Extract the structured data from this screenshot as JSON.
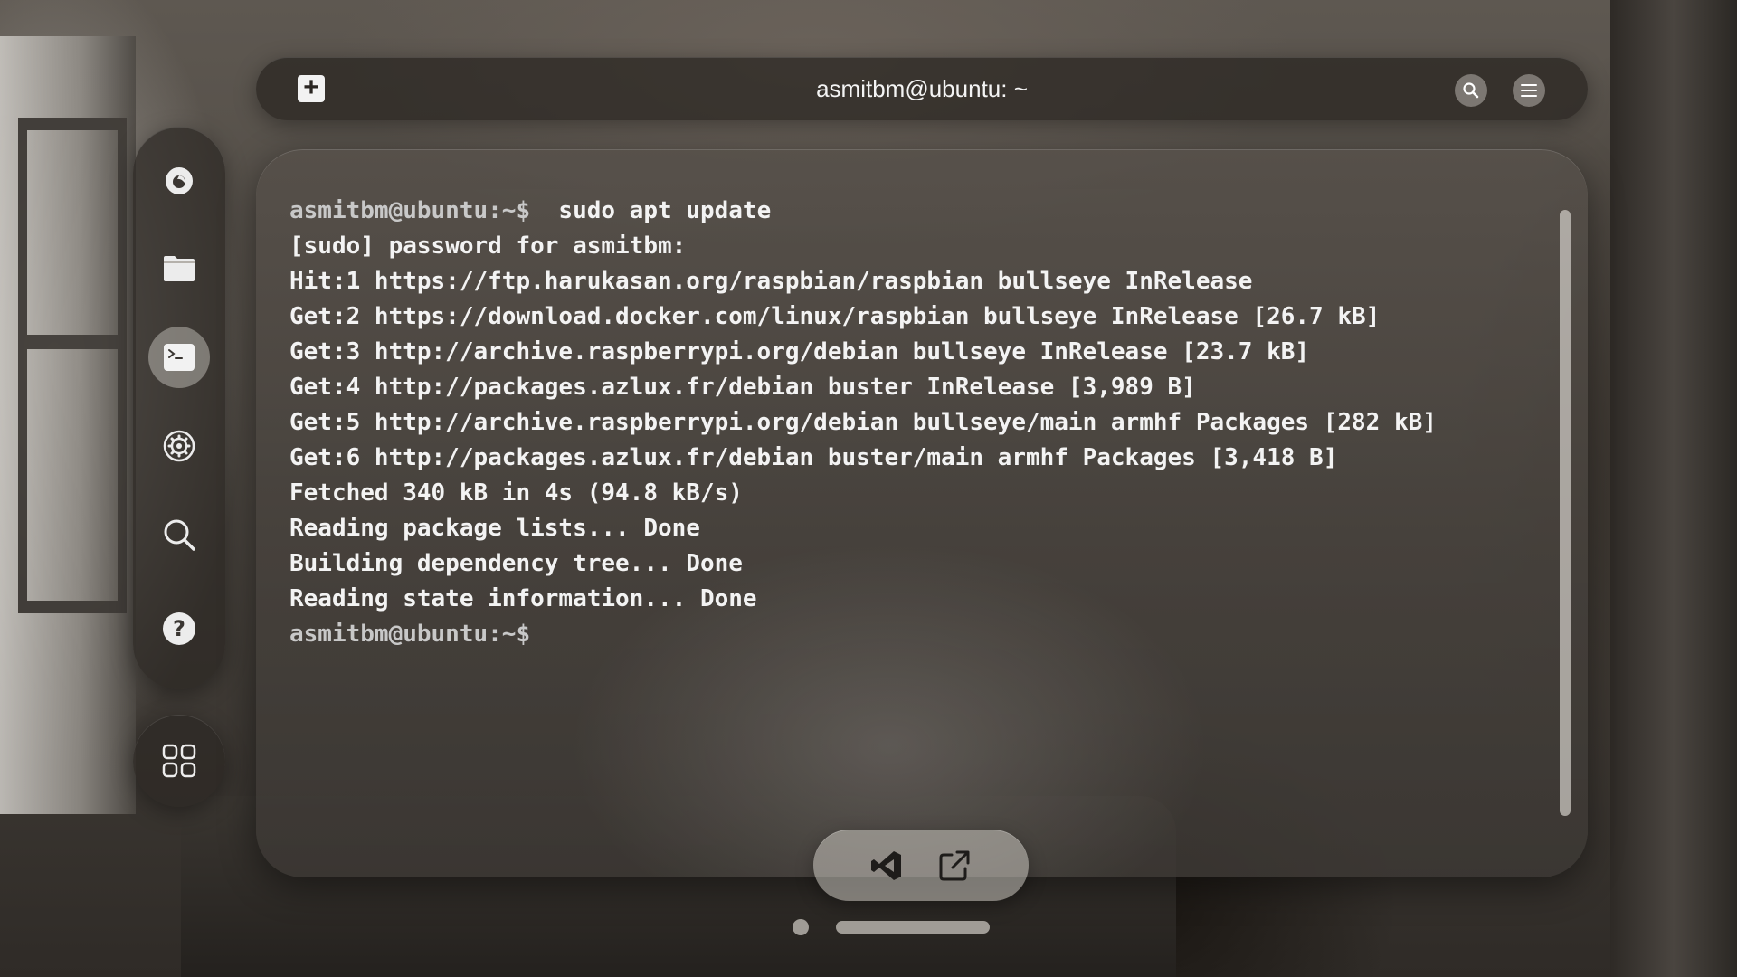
{
  "window": {
    "title": "asmitbm@ubuntu: ~"
  },
  "topbar": {
    "new_tab_icon": "plus-square-icon",
    "search_icon": "search-icon",
    "menu_icon": "hamburger-menu-icon"
  },
  "dock": {
    "items": [
      {
        "name": "firefox",
        "icon": "firefox-icon",
        "active": false
      },
      {
        "name": "files",
        "icon": "folder-icon",
        "active": false
      },
      {
        "name": "terminal",
        "icon": "terminal-icon",
        "active": true
      },
      {
        "name": "settings",
        "icon": "gear-icon",
        "active": false
      },
      {
        "name": "search",
        "icon": "search-icon",
        "active": false
      },
      {
        "name": "help",
        "icon": "help-icon",
        "active": false
      }
    ],
    "apps_icon": "app-grid-icon"
  },
  "terminal": {
    "lines": [
      {
        "prompt": "asmitbm@ubuntu:~$",
        "text": "  sudo apt update"
      },
      {
        "prompt": "",
        "text": "[sudo] password for asmitbm:"
      },
      {
        "prompt": "",
        "text": "Hit:1 https://ftp.harukasan.org/raspbian/raspbian bullseye InRelease"
      },
      {
        "prompt": "",
        "text": "Get:2 https://download.docker.com/linux/raspbian bullseye InRelease [26.7 kB]"
      },
      {
        "prompt": "",
        "text": "Get:3 http://archive.raspberrypi.org/debian bullseye InRelease [23.7 kB]"
      },
      {
        "prompt": "",
        "text": "Get:4 http://packages.azlux.fr/debian buster InRelease [3,989 B]"
      },
      {
        "prompt": "",
        "text": "Get:5 http://archive.raspberrypi.org/debian bullseye/main armhf Packages [282 kB]"
      },
      {
        "prompt": "",
        "text": "Get:6 http://packages.azlux.fr/debian buster/main armhf Packages [3,418 B]"
      },
      {
        "prompt": "",
        "text": "Fetched 340 kB in 4s (94.8 kB/s)"
      },
      {
        "prompt": "",
        "text": "Reading package lists... Done"
      },
      {
        "prompt": "",
        "text": "Building dependency tree... Done"
      },
      {
        "prompt": "",
        "text": "Reading state information... Done"
      },
      {
        "prompt": "asmitbm@ubuntu:~$",
        "text": ""
      }
    ],
    "scroll_position": 1.0
  },
  "bottom_pill": {
    "vscode_icon": "vscode-icon",
    "external_icon": "open-external-icon"
  },
  "page_indicator": {
    "pages": 2,
    "current": 2
  }
}
